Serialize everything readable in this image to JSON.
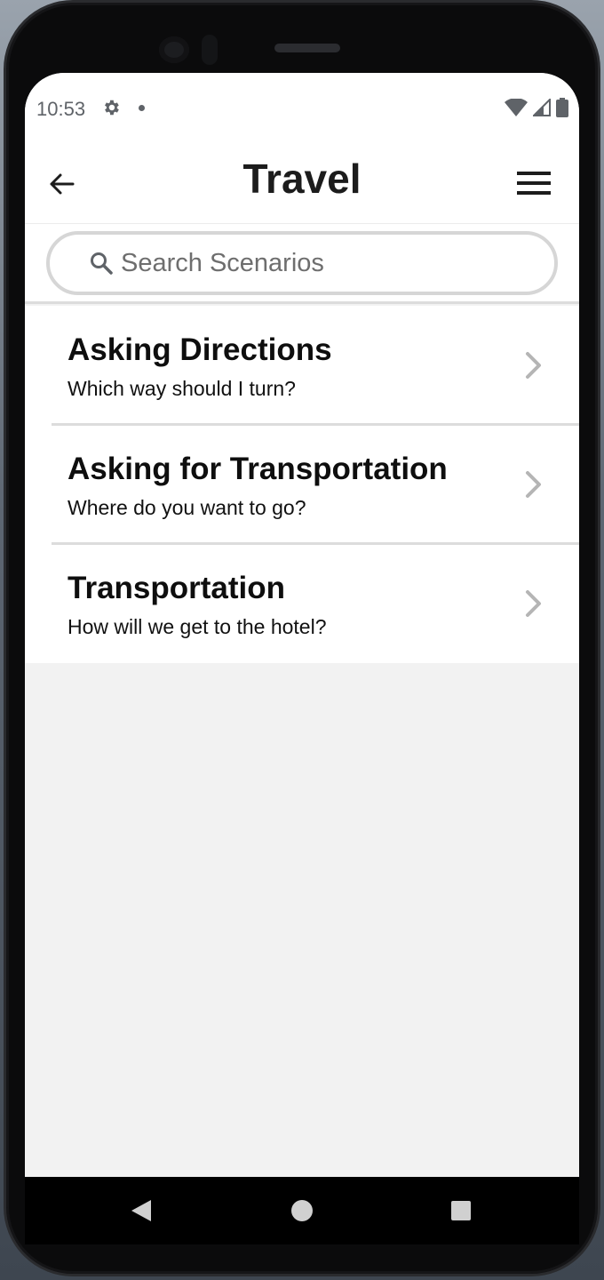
{
  "status_bar": {
    "time": "10:53",
    "icons": [
      "gear-icon",
      "notification-dot-icon",
      "wifi-icon",
      "signal-icon",
      "battery-icon"
    ]
  },
  "header": {
    "title": "Travel",
    "back_icon": "arrow-left-icon",
    "menu_icon": "hamburger-menu-icon"
  },
  "search": {
    "placeholder": "Search Scenarios",
    "value": ""
  },
  "scenarios": [
    {
      "title": "Asking Directions",
      "subtitle": "Which way should I turn?"
    },
    {
      "title": "Asking for Transportation",
      "subtitle": "Where do you want to go?"
    },
    {
      "title": "Transportation",
      "subtitle": "How will we get to the hotel?"
    }
  ],
  "colors": {
    "background": "#f2f2f2",
    "surface": "#ffffff",
    "divider": "#dcdcdc",
    "chevron": "#b5b5b5"
  }
}
